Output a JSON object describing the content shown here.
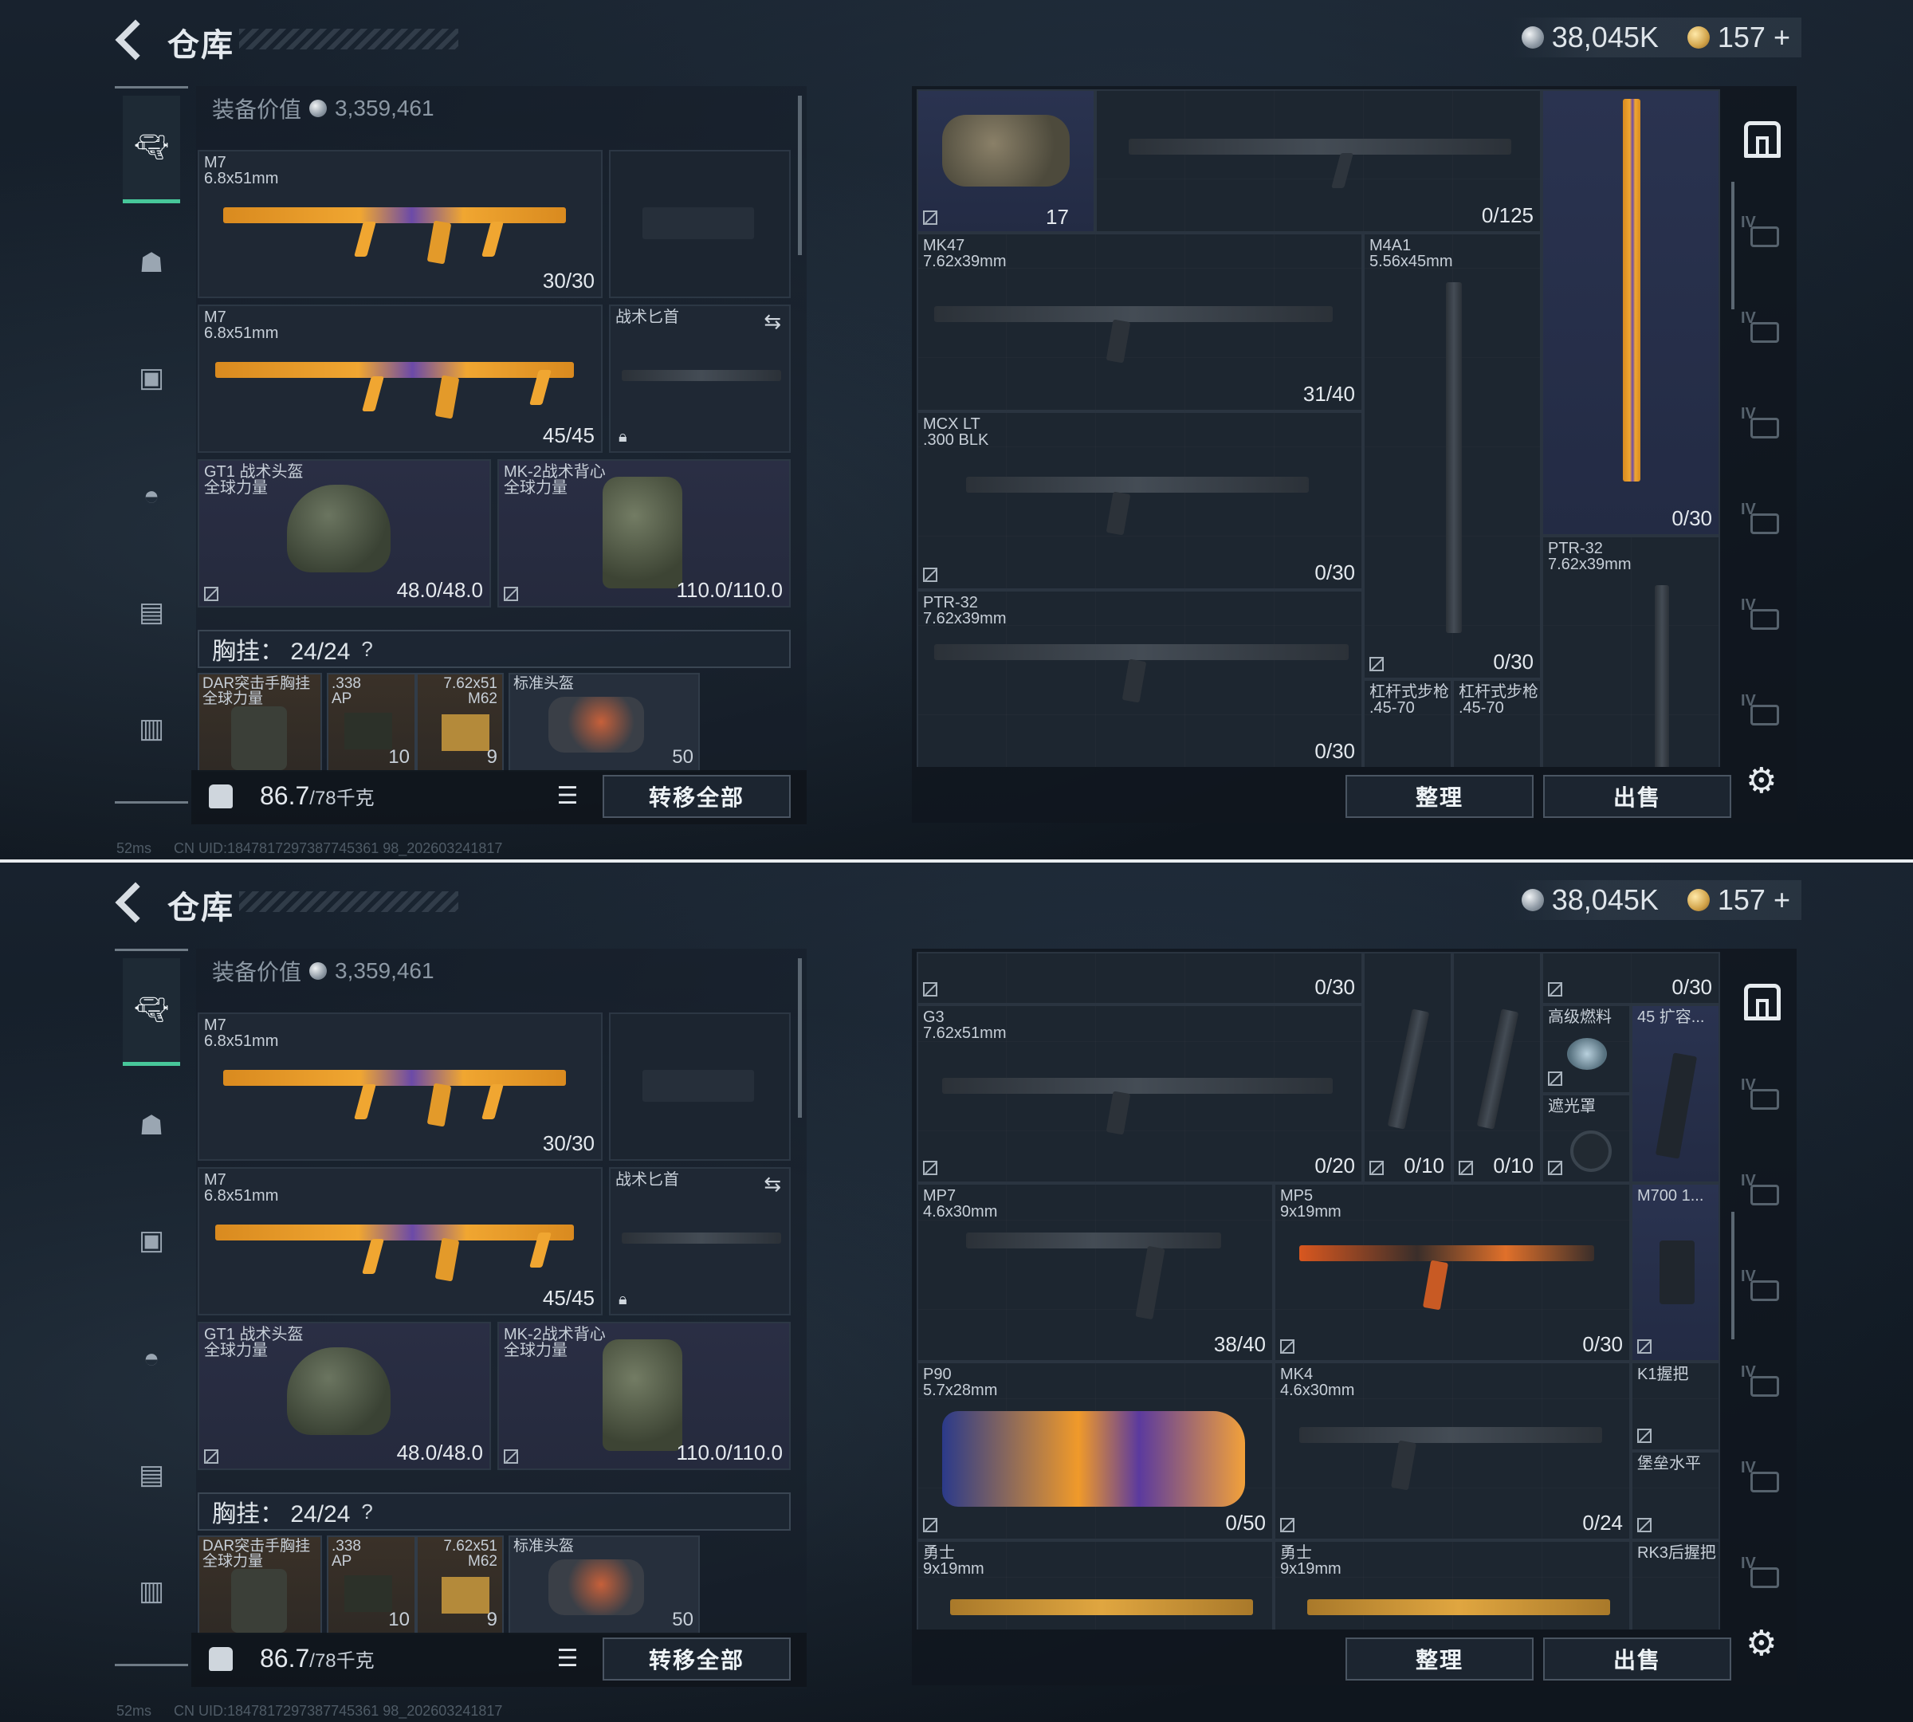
{
  "header": {
    "title": "仓库",
    "currency_silver": "38,045K",
    "currency_gold": "157",
    "currency_plus": "+"
  },
  "equipment": {
    "value_label": "装备价值",
    "value": "3,359,461",
    "primary1": {
      "name": "M7",
      "caliber": "6.8x51mm",
      "ammo": "30/30"
    },
    "primary2": {
      "name": "M7",
      "caliber": "6.8x51mm",
      "ammo": "45/45"
    },
    "knife": {
      "name": "战术匕首"
    },
    "helmet": {
      "name": "GT1 战术头盔",
      "brand": "全球力量",
      "durability": "48.0/48.0"
    },
    "armor": {
      "name": "MK-2战术背心",
      "brand": "全球力量",
      "durability": "110.0/110.0"
    },
    "rig_label": "胸挂：",
    "rig_capacity": "24/24",
    "rig_help": "?",
    "rig_items": [
      {
        "name": "DAR突击手胸挂",
        "sub": "全球力量",
        "count": ""
      },
      {
        "name": ".338",
        "sub": "AP",
        "count": "10"
      },
      {
        "name": "7.62x51",
        "sub": "M62",
        "count": "9"
      },
      {
        "name": "标准头盔",
        "sub": "",
        "count": "50"
      }
    ],
    "weight": "86.7",
    "weight_max": "/78千克",
    "transfer_all": "转移全部"
  },
  "status_bar": {
    "ping": "52ms",
    "uid": "CN UID:1847817297387745361 98_202603241817"
  },
  "stash": {
    "sort_button": "整理",
    "sell_button": "出售",
    "top_items": [
      {
        "name": "",
        "caliber": "",
        "count": "",
        "extra": "17"
      },
      {
        "name": "",
        "caliber": "",
        "count": "0/125"
      },
      {
        "name": "MK47",
        "caliber": "7.62x39mm",
        "count": "31/40"
      },
      {
        "name": "M4A1",
        "caliber": "5.56x45mm",
        "count": "0/30"
      },
      {
        "name": "",
        "caliber": "",
        "count": "0/30"
      },
      {
        "name": "MCX LT",
        "caliber": ".300 BLK",
        "count": "0/30"
      },
      {
        "name": "PTR-32",
        "caliber": "7.62x39mm",
        "count": ""
      },
      {
        "name": "PTR-32",
        "caliber": "7.62x39mm",
        "count": "0/30"
      },
      {
        "name": "杠杆式步枪",
        "caliber": ".45-70",
        "count": ""
      },
      {
        "name": "杠杆式步枪",
        "caliber": ".45-70",
        "count": ""
      }
    ],
    "bottom_items": [
      {
        "name": "",
        "caliber": "",
        "count": "0/30"
      },
      {
        "name": "",
        "caliber": "",
        "count": "0/30"
      },
      {
        "name": "G3",
        "caliber": "7.62x51mm",
        "count": "0/20"
      },
      {
        "name": "",
        "caliber": "",
        "count": "0/10"
      },
      {
        "name": "",
        "caliber": "",
        "count": "0/10"
      },
      {
        "name": "高级燃料",
        "caliber": "",
        "count": ""
      },
      {
        "name": "遮光罩",
        "caliber": "",
        "count": ""
      },
      {
        "name": "45 扩容...",
        "caliber": "",
        "count": ""
      },
      {
        "name": "MP7",
        "caliber": "4.6x30mm",
        "count": "38/40"
      },
      {
        "name": "MP5",
        "caliber": "9x19mm",
        "count": "0/30"
      },
      {
        "name": "M700 1...",
        "caliber": "",
        "count": ""
      },
      {
        "name": "P90",
        "caliber": "5.7x28mm",
        "count": "0/50"
      },
      {
        "name": "MK4",
        "caliber": "4.6x30mm",
        "count": "0/24"
      },
      {
        "name": "K1握把",
        "caliber": "",
        "count": ""
      },
      {
        "name": "堡垒水平",
        "caliber": "",
        "count": ""
      },
      {
        "name": "勇士",
        "caliber": "9x19mm",
        "count": ""
      },
      {
        "name": "勇士",
        "caliber": "9x19mm",
        "count": ""
      },
      {
        "name": "RK3后握把",
        "caliber": "",
        "count": ""
      }
    ],
    "side_levels": [
      "IV",
      "IV",
      "IV",
      "IV",
      "IV",
      "IV"
    ]
  },
  "colors": {
    "accent_green": "#47c79a",
    "weapon_orange": "#f0a631",
    "weapon_purple": "#6b4aa8"
  },
  "icons": [
    "back-arrow-icon",
    "silver-coin-icon",
    "gold-coin-icon",
    "pistol-icon",
    "armor-icon",
    "backpack-icon",
    "helmet-icon",
    "container-icon",
    "case-icon",
    "lock-icon",
    "swap-icon",
    "list-icon",
    "home-icon",
    "gear-icon",
    "no-sell-icon"
  ]
}
